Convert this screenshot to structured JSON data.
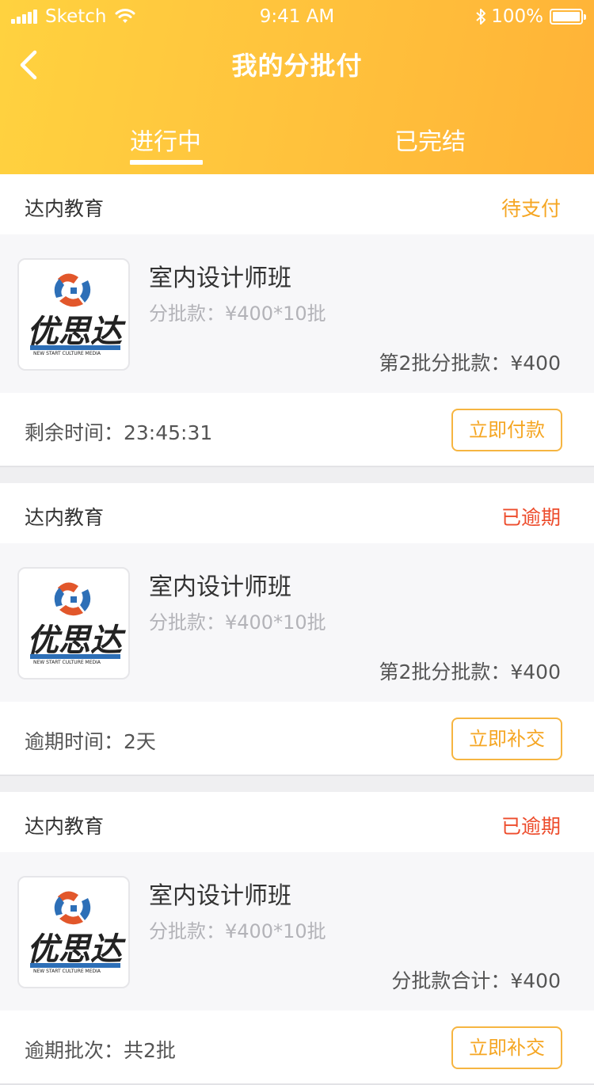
{
  "status_bar": {
    "carrier": "Sketch",
    "time": "9:41 AM",
    "battery": "100%"
  },
  "nav": {
    "title": "我的分批付"
  },
  "tabs": [
    {
      "label": "进行中",
      "active": true
    },
    {
      "label": "已完结",
      "active": false
    }
  ],
  "colors": {
    "header_start": "#ffd23f",
    "header_end": "#ffb337",
    "pending": "#f5a623",
    "overdue": "#ed4c2c",
    "button_border": "#f6b541"
  },
  "orders": [
    {
      "shop": "达内教育",
      "status": "待支付",
      "status_type": "pending",
      "course": "室内设计师班",
      "batch_info": "分批款：¥400*10批",
      "amount": "第2批分批款：¥400",
      "footer_label": "剩余时间：23:45:31",
      "button": "立即付款"
    },
    {
      "shop": "达内教育",
      "status": "已逾期",
      "status_type": "overdue",
      "course": "室内设计师班",
      "batch_info": "分批款：¥400*10批",
      "amount": "第2批分批款：¥400",
      "footer_label": "逾期时间：2天",
      "button": "立即补交"
    },
    {
      "shop": "达内教育",
      "status": "已逾期",
      "status_type": "overdue",
      "course": "室内设计师班",
      "batch_info": "分批款：¥400*10批",
      "amount": "分批款合计：¥400",
      "footer_label": "逾期批次：共2批",
      "button": "立即补交"
    }
  ],
  "logo": {
    "text": "优思达",
    "subtext": "NEW START CULTURE MEDIA"
  }
}
